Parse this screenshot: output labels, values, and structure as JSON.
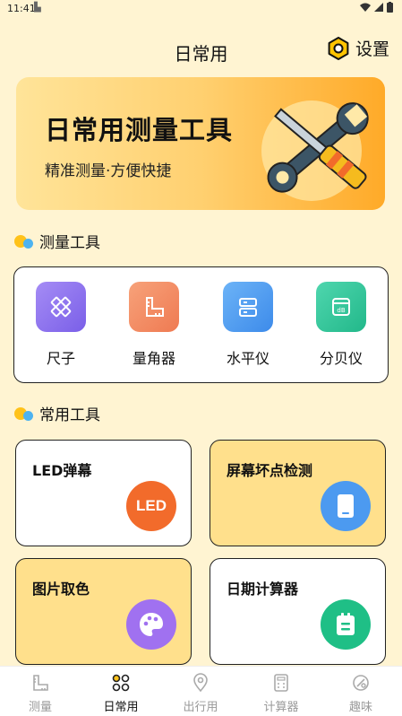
{
  "status_bar": {
    "time": "11:41"
  },
  "header": {
    "title": "日常用",
    "settings_label": "设置"
  },
  "banner": {
    "title": "日常用测量工具",
    "subtitle": "精准测量·方便快捷"
  },
  "sections": {
    "measure_title": "测量工具",
    "common_title": "常用工具"
  },
  "measure_tools": [
    {
      "label": "尺子",
      "icon": "ruler-icon",
      "color": "#8E73EE"
    },
    {
      "label": "量角器",
      "icon": "protractor-icon",
      "color": "#F2845A"
    },
    {
      "label": "水平仪",
      "icon": "level-icon",
      "color": "#4C9AF0"
    },
    {
      "label": "分贝仪",
      "icon": "decibel-icon",
      "color": "#2EC59A"
    }
  ],
  "common_tools": [
    {
      "label": "LED弹幕",
      "badge_text": "LED",
      "color": "#F26B2B"
    },
    {
      "label": "屏幕坏点检测",
      "icon": "phone-icon",
      "color": "#4C9AF0"
    },
    {
      "label": "图片取色",
      "icon": "palette-icon",
      "color": "#A071F0"
    },
    {
      "label": "日期计算器",
      "icon": "calendar-icon",
      "color": "#1FBF86"
    }
  ],
  "bottom_nav": [
    {
      "label": "测量",
      "icon": "ruler-icon"
    },
    {
      "label": "日常用",
      "icon": "grid-icon",
      "active": true
    },
    {
      "label": "出行用",
      "icon": "location-icon"
    },
    {
      "label": "计算器",
      "icon": "calculator-icon"
    },
    {
      "label": "趣味",
      "icon": "fun-icon"
    }
  ]
}
